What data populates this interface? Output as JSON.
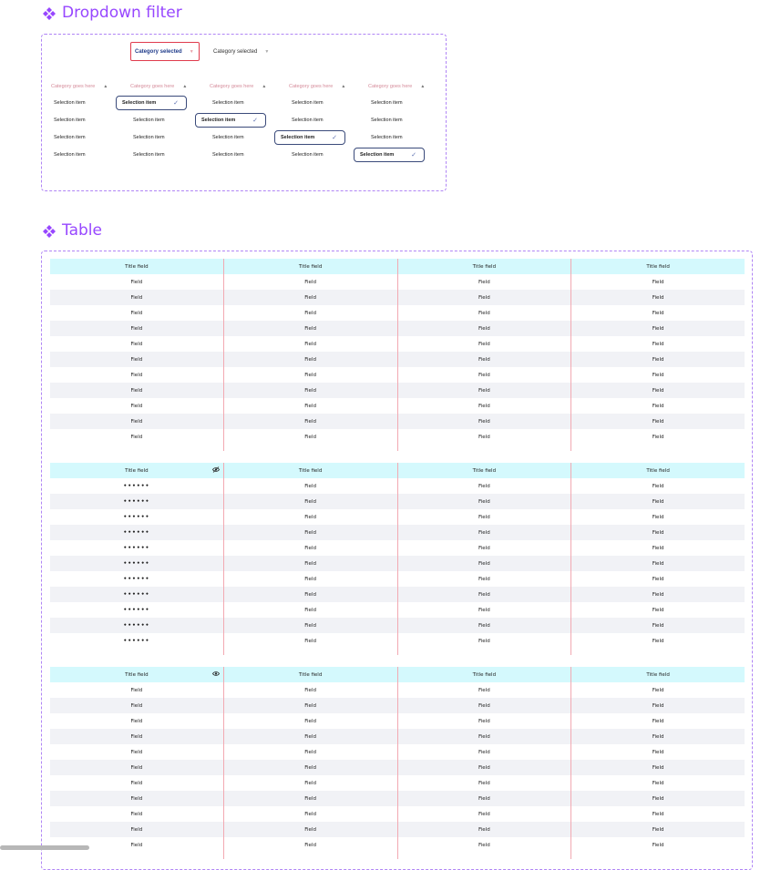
{
  "dropdown_section": {
    "title": "Dropdown filter",
    "triggers": [
      {
        "label": "Category selected",
        "state": "active"
      },
      {
        "label": "Category selected",
        "state": "idle"
      }
    ],
    "columns": [
      {
        "header": "Category goes here",
        "items": [
          "Selection item",
          "Selection item",
          "Selection item",
          "Selection item"
        ],
        "selected_index": -1
      },
      {
        "header": "Category goes here",
        "items": [
          "Selection item",
          "Selection item",
          "Selection item",
          "Selection item"
        ],
        "selected_index": 0
      },
      {
        "header": "Category goes here",
        "items": [
          "Selection item",
          "Selection item",
          "Selection item",
          "Selection item"
        ],
        "selected_index": 1
      },
      {
        "header": "Category goes here",
        "items": [
          "Selection item",
          "Selection item",
          "Selection item",
          "Selection item"
        ],
        "selected_index": 2
      },
      {
        "header": "Category goes here",
        "items": [
          "Selection item",
          "Selection item",
          "Selection item",
          "Selection item"
        ],
        "selected_index": 3
      }
    ],
    "icons": {
      "caret": "caret-down-icon",
      "header_caret": "caret-up-icon",
      "check": "check-icon"
    }
  },
  "table_section": {
    "title": "Table",
    "tables": [
      {
        "headers": [
          "Title field",
          "Title field",
          "Title field",
          "Title field"
        ],
        "header_icon": "",
        "first_col_masked": false,
        "row_count": 11,
        "field_text": "Field"
      },
      {
        "headers": [
          "Title field",
          "Title field",
          "Title field",
          "Title field"
        ],
        "header_icon": "eye-off-icon",
        "first_col_masked": true,
        "row_count": 11,
        "field_text": "Field",
        "mask_text": "••••••"
      },
      {
        "headers": [
          "Title field",
          "Title field",
          "Title field",
          "Title field"
        ],
        "header_icon": "eye-icon",
        "first_col_masked": false,
        "row_count": 11,
        "field_text": "Field"
      }
    ]
  },
  "colors": {
    "accent": "#9747ff",
    "header_bg": "#d4f9fd",
    "row_shade": "#f1f2f6",
    "divider": "#f2a9b2",
    "active_border": "#e03b4d",
    "selected_text": "#1f3b8a"
  }
}
